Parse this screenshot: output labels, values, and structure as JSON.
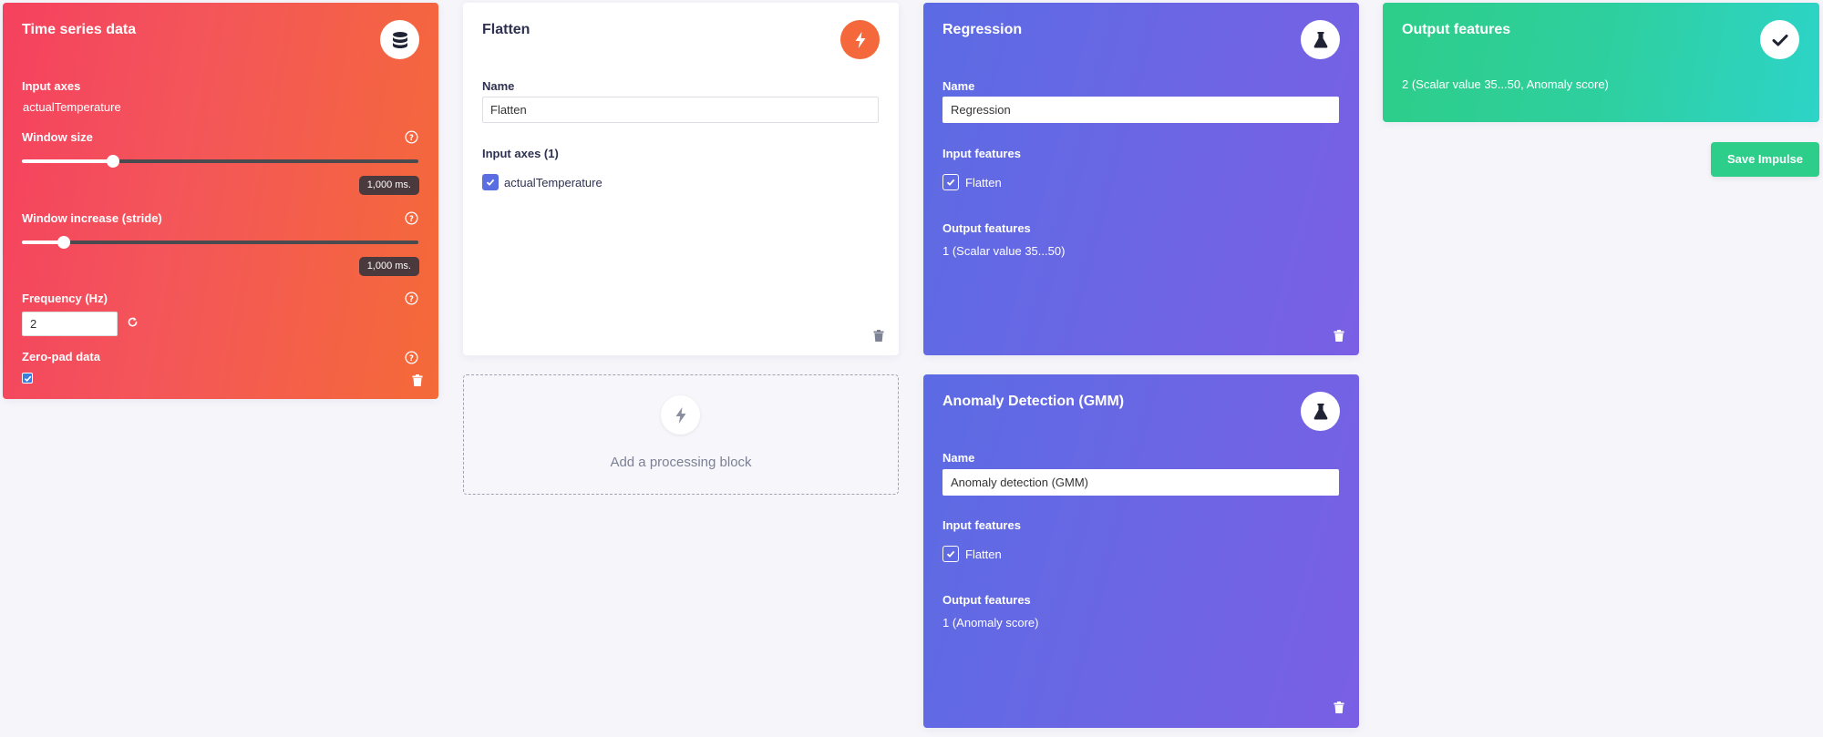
{
  "time_series": {
    "title": "Time series data",
    "icon": "database-icon",
    "input_axes_label": "Input axes",
    "input_axes_value": "actualTemperature",
    "window_size_label": "Window size",
    "window_size_value": "1,000 ms.",
    "window_size_fraction": 0.23,
    "window_increase_label": "Window increase (stride)",
    "window_increase_value": "1,000 ms.",
    "window_increase_fraction": 0.105,
    "frequency_label": "Frequency (Hz)",
    "frequency_value": "2",
    "zero_pad_label": "Zero-pad data",
    "zero_pad_checked": true,
    "color": "#f5415f"
  },
  "flatten": {
    "title": "Flatten",
    "icon": "bolt-icon",
    "name_label": "Name",
    "name_value": "Flatten",
    "input_axes_label": "Input axes (1)",
    "axes": [
      {
        "label": "actualTemperature",
        "checked": true
      }
    ],
    "icon_color": "#f4683c"
  },
  "add_block": {
    "label": "Add a processing block",
    "icon": "bolt-icon"
  },
  "regression": {
    "title": "Regression",
    "icon": "flask-icon",
    "name_label": "Name",
    "name_value": "Regression",
    "input_features_label": "Input features",
    "input_features": [
      {
        "label": "Flatten",
        "checked": true
      }
    ],
    "output_features_label": "Output features",
    "output_features_value": "1 (Scalar value 35...50)"
  },
  "anomaly": {
    "title": "Anomaly Detection (GMM)",
    "icon": "flask-icon",
    "name_label": "Name",
    "name_value": "Anomaly detection (GMM)",
    "input_features_label": "Input features",
    "input_features": [
      {
        "label": "Flatten",
        "checked": true
      }
    ],
    "output_features_label": "Output features",
    "output_features_value": "1 (Anomaly score)"
  },
  "output": {
    "title": "Output features",
    "icon": "check-icon",
    "value": "2 (Scalar value 35...50, Anomaly score)"
  },
  "save_button": "Save Impulse"
}
